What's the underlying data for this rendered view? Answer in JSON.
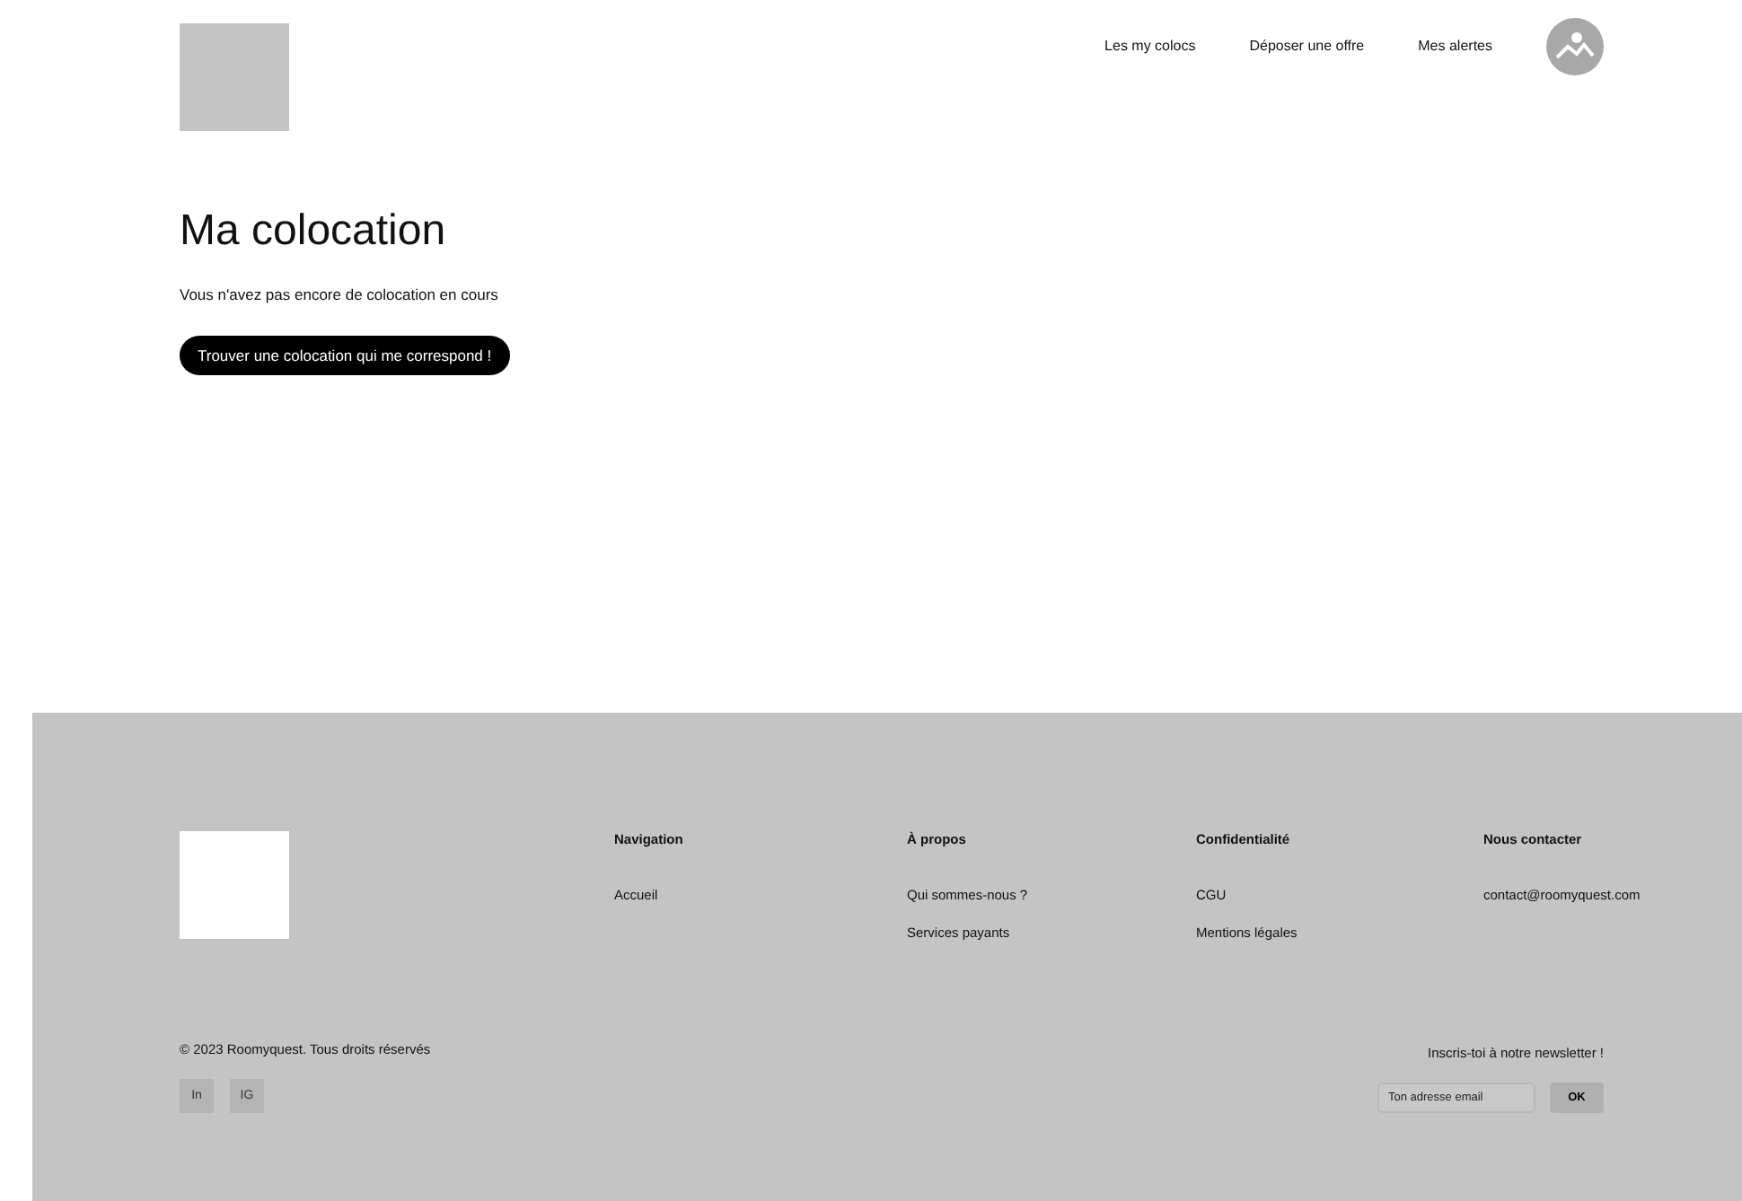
{
  "header": {
    "nav": [
      "Les my colocs",
      "Déposer une offre",
      "Mes alertes"
    ]
  },
  "main": {
    "title": "Ma colocation",
    "message": "Vous n'avez pas encore de colocation en cours",
    "cta": "Trouver une colocation qui me correspond !"
  },
  "footer": {
    "columns": [
      {
        "title": "Navigation",
        "links": [
          "Accueil"
        ]
      },
      {
        "title": "À propos",
        "links": [
          "Qui sommes-nous ?",
          "Services payants"
        ]
      },
      {
        "title": "Confidentialité",
        "links": [
          "CGU",
          "Mentions légales"
        ]
      },
      {
        "title": "Nous contacter",
        "links": [
          "contact@roomyquest.com"
        ]
      }
    ],
    "copyright": "© 2023 Roomyquest. Tous droits réservés",
    "social": [
      "In",
      "IG"
    ],
    "newsletter": {
      "label": "Inscris-toi à notre newsletter !",
      "placeholder": "Ton adresse email",
      "button": "OK"
    }
  }
}
